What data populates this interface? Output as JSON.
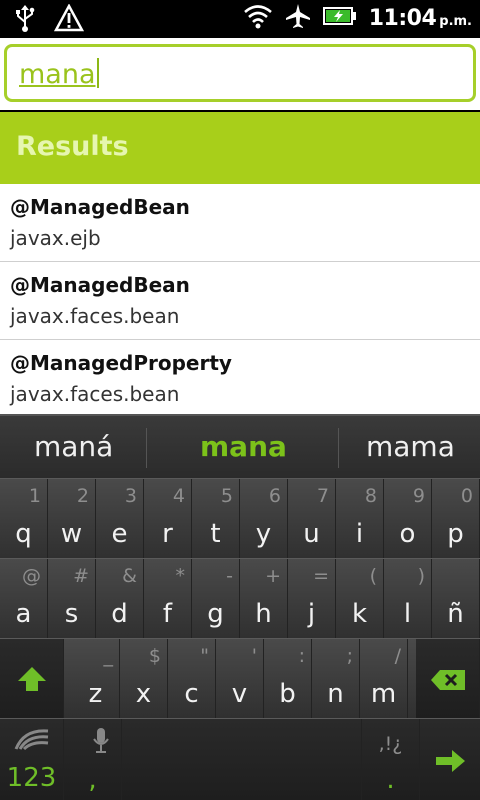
{
  "status_bar": {
    "time": "11:04",
    "ampm": "p.m.",
    "icons": [
      "usb-icon",
      "warning-icon",
      "wifi-icon",
      "airplane-icon",
      "battery-icon"
    ]
  },
  "search": {
    "value": "mana"
  },
  "results": {
    "title": "Results",
    "items": [
      {
        "title": "@ManagedBean",
        "subtitle": "javax.ejb"
      },
      {
        "title": "@ManagedBean",
        "subtitle": "javax.faces.bean"
      },
      {
        "title": "@ManagedProperty",
        "subtitle": "javax.faces.bean"
      }
    ]
  },
  "keyboard": {
    "suggestions": [
      "maná",
      "mana",
      "mama"
    ],
    "row1": {
      "main": [
        "q",
        "w",
        "e",
        "r",
        "t",
        "y",
        "u",
        "i",
        "o",
        "p"
      ],
      "alt": [
        "1",
        "2",
        "3",
        "4",
        "5",
        "6",
        "7",
        "8",
        "9",
        "0"
      ]
    },
    "row2": {
      "main": [
        "a",
        "s",
        "d",
        "f",
        "g",
        "h",
        "j",
        "k",
        "l",
        "ñ"
      ],
      "alt": [
        "@",
        "#",
        "&",
        "*",
        "-",
        "+",
        "=",
        "(",
        ")",
        ""
      ]
    },
    "row3": {
      "main": [
        "z",
        "x",
        "c",
        "v",
        "b",
        "n",
        "m"
      ],
      "alt": [
        "_",
        "$",
        "\"",
        "'",
        ":",
        ";",
        "/"
      ]
    },
    "row4": {
      "numbers_label": "123",
      "comma": ",",
      "punct_alt": ",!¿",
      "period": "."
    },
    "accent_color": "#7cc21a"
  },
  "colors": {
    "header_green": "#a8cf1a",
    "search_border": "#a6cf2a"
  }
}
